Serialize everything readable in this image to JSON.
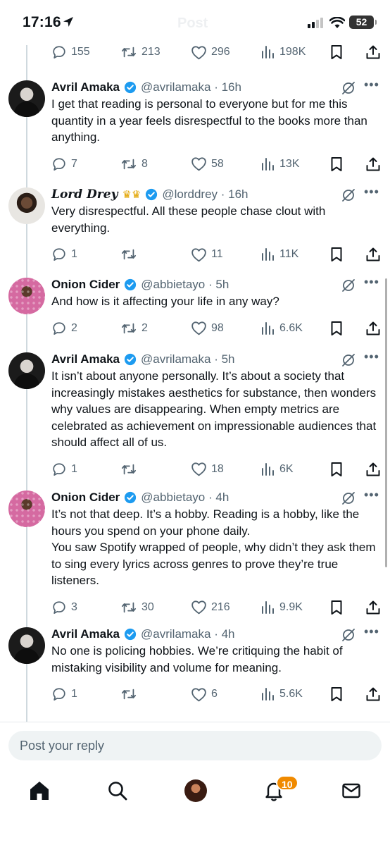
{
  "status_bar": {
    "time": "17:16",
    "battery": "52",
    "ghost_title": "Post"
  },
  "top_actions": {
    "replies": "155",
    "reposts": "213",
    "likes": "296",
    "views": "198K"
  },
  "tweets": [
    {
      "name": "Avril Amaka",
      "handle": "@avrilamaka",
      "time": "· 16h",
      "text": "I get that reading is personal to everyone but for me this quantity in a year feels disrespectful to the books more than anything.",
      "replies": "7",
      "reposts": "8",
      "likes": "58",
      "views": "13K"
    },
    {
      "name": "𝓛𝓸𝓻𝓭 𝓓𝓻𝓮𝔂",
      "name_plain": "Lord Drey",
      "handle": "@lorddrey",
      "time": "· 16h",
      "text": "Very disrespectful. All these people chase clout with everything.",
      "replies": "1",
      "reposts": "",
      "likes": "11",
      "views": "11K"
    },
    {
      "name": "Onion Cider",
      "handle": "@abbietayo",
      "time": "· 5h",
      "text": "And how is it affecting your life in any way?",
      "replies": "2",
      "reposts": "2",
      "likes": "98",
      "views": "6.6K"
    },
    {
      "name": "Avril Amaka",
      "handle": "@avrilamaka",
      "time": "· 5h",
      "text": "It isn’t about anyone personally. It’s about a society that increasingly mistakes aesthetics for substance, then wonders why values are disappearing. When empty metrics are celebrated as achievement on impressionable audiences that should affect all of us.",
      "replies": "1",
      "reposts": "",
      "likes": "18",
      "views": "6K"
    },
    {
      "name": "Onion Cider",
      "handle": "@abbietayo",
      "time": "· 4h",
      "text": "It’s not that deep. It’s a hobby. Reading is a hobby, like the hours you spend on your phone daily.\nYou saw Spotify wrapped of people, why didn’t they ask them to sing every lyrics across genres to prove they’re true listeners.",
      "replies": "3",
      "reposts": "30",
      "likes": "216",
      "views": "9.9K"
    },
    {
      "name": "Avril Amaka",
      "handle": "@avrilamaka",
      "time": "· 4h",
      "text": "No one is policing hobbies. We’re critiquing the habit of mistaking visibility and volume for meaning.",
      "replies": "1",
      "reposts": "",
      "likes": "6",
      "views": "5.6K"
    }
  ],
  "reply_bar": {
    "placeholder": "Post your reply"
  },
  "bottom_nav": {
    "notification_count": "10",
    "icons": [
      "home-icon",
      "search-icon",
      "profile-avatar",
      "bell-icon",
      "mail-icon"
    ]
  },
  "colors": {
    "text": "#0f1419",
    "muted": "#536471",
    "verified": "#1d9bf0",
    "badge": "#f08a00"
  }
}
